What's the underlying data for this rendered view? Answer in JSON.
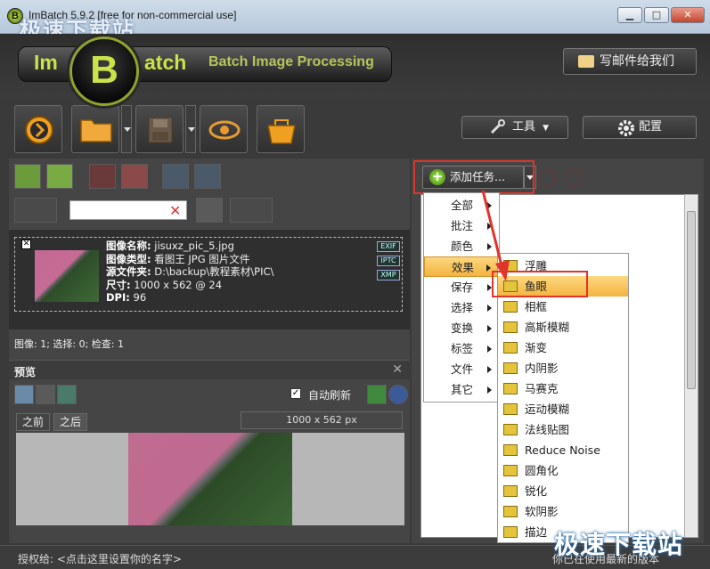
{
  "window": {
    "title": "ImBatch 5.9.2 [free for non-commercial use]",
    "watermark_top": "极速下载站",
    "buttons": {
      "minimize": "▁",
      "maximize": "□",
      "close": "✕"
    }
  },
  "header": {
    "logo_left": "Im",
    "logo_center": "B",
    "logo_right": "atch",
    "tagline": "Batch Image Processing",
    "email_label": "写邮件给我们"
  },
  "toolbar": {
    "tools_label": "工具",
    "config_label": "配置"
  },
  "search": {
    "value": ""
  },
  "file": {
    "name_label": "图像名称:",
    "name_value": "jisuxz_pic_5.jpg",
    "type_label": "图像类型:",
    "type_value": "看图王 JPG 图片文件",
    "src_label": "源文件夹:",
    "src_value": "D:\\backup\\教程素材\\PIC\\",
    "size_label": "尺寸:",
    "size_value": "1000 x 562 @ 24",
    "dpi_label": "DPI:",
    "dpi_value": "96",
    "tags": [
      "EXIF",
      "IPTC",
      "XMP"
    ]
  },
  "status": "图像: 1; 选择: 0; 检查: 1",
  "preview": {
    "title": "预览",
    "auto_refresh": "自动刷新",
    "tab_before": "之前",
    "tab_after": "之后",
    "size": "1000 x 562 px"
  },
  "tasks": {
    "add_task": "添加任务..."
  },
  "menu1": [
    "全部",
    "批注",
    "颜色",
    "效果",
    "保存",
    "选择",
    "变换",
    "标签",
    "文件",
    "其它"
  ],
  "menu1_selected": "效果",
  "menu2": [
    "浮雕",
    "鱼眼",
    "相框",
    "高斯模糊",
    "渐变",
    "内阴影",
    "马赛克",
    "运动模糊",
    "法线贴图",
    "Reduce Noise",
    "圆角化",
    "锐化",
    "软阴影",
    "描边"
  ],
  "menu2_selected": "鱼眼",
  "bottom": {
    "license": "授权给:   <点击这里设置你的名字>",
    "version": "你已在使用最新的版本",
    "watermark": "极速下载站"
  },
  "colors": {
    "accent": "#c9e34a",
    "highlight": "#f4b340",
    "callout": "#e0342a"
  }
}
